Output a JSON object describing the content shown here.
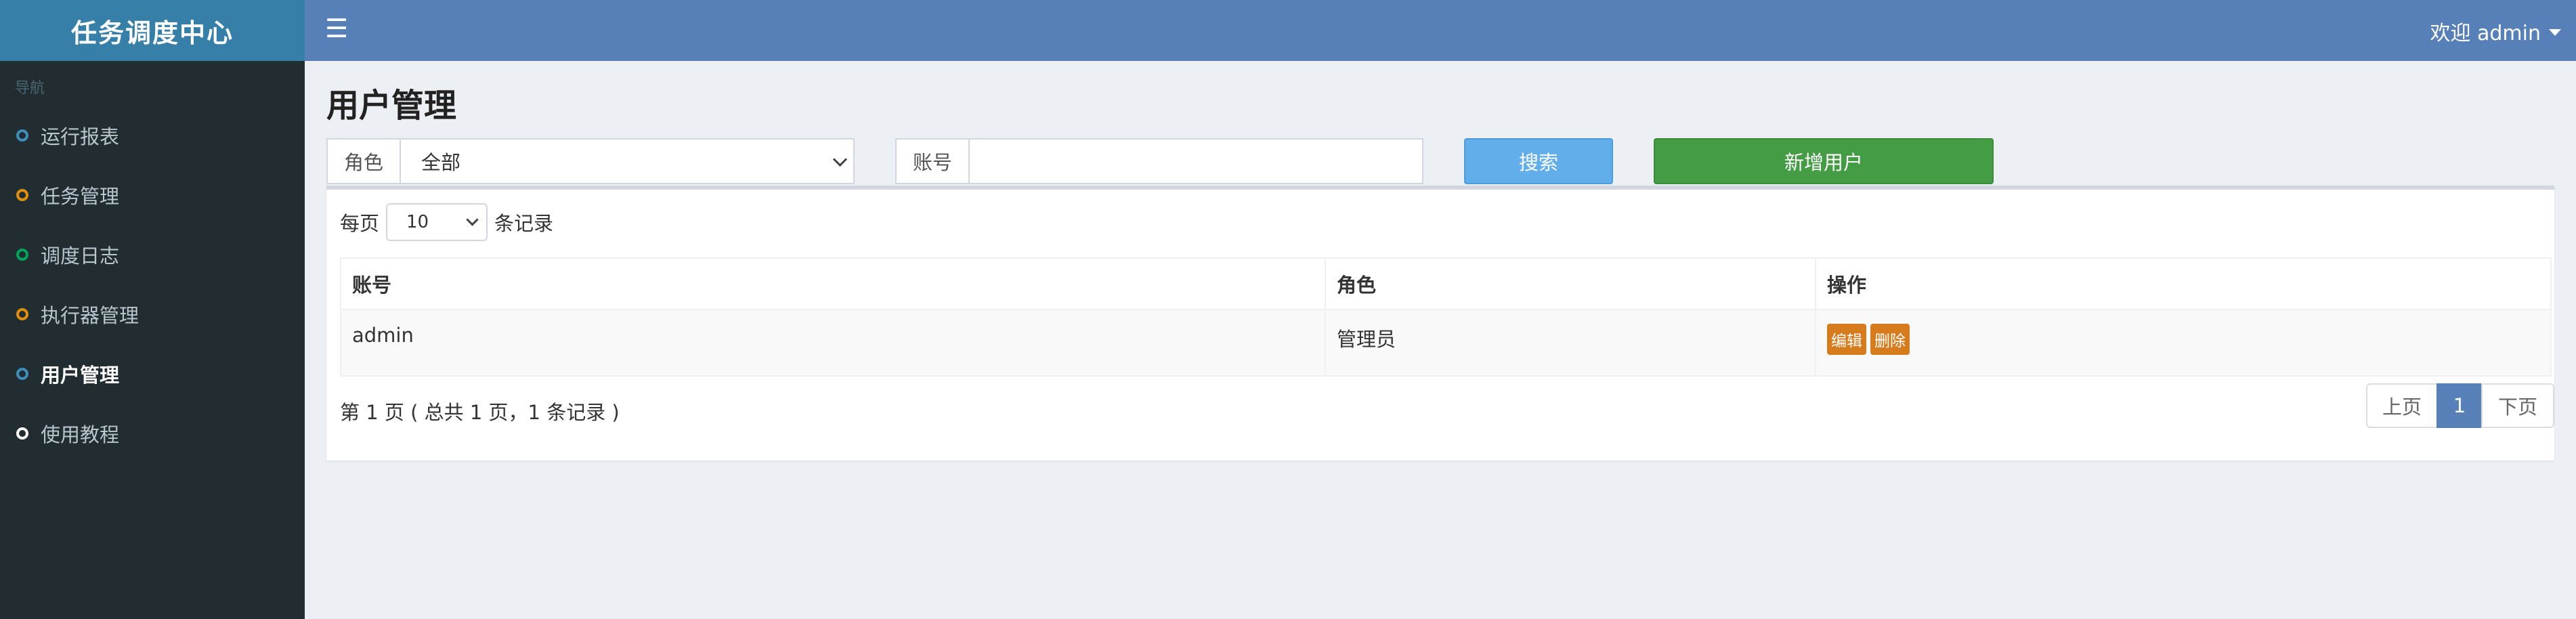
{
  "brand": "任务调度中心",
  "header": {
    "welcome": "欢迎 admin"
  },
  "sidebar": {
    "section": "导航",
    "items": [
      {
        "label": "运行报表",
        "color": "#3c8dbc"
      },
      {
        "label": "任务管理",
        "color": "#e08e0b"
      },
      {
        "label": "调度日志",
        "color": "#00a65a"
      },
      {
        "label": "执行器管理",
        "color": "#e08e0b"
      },
      {
        "label": "用户管理",
        "color": "#3c8dbc",
        "active": true
      },
      {
        "label": "使用教程",
        "color": "#ffffff"
      }
    ]
  },
  "main": {
    "title": "用户管理",
    "filters": {
      "role_label": "角色",
      "role_value": "全部",
      "account_label": "账号",
      "account_value": ""
    },
    "buttons": {
      "search": "搜索",
      "add": "新增用户"
    },
    "per_page": {
      "prefix": "每页",
      "value": "10",
      "suffix": "条记录"
    },
    "table": {
      "columns": [
        "账号",
        "角色",
        "操作"
      ],
      "rows": [
        {
          "account": "admin",
          "role": "管理员",
          "actions": [
            "编辑",
            "删除"
          ]
        }
      ]
    },
    "summary": "第 1 页 ( 总共 1 页，1 条记录 )",
    "pagination": {
      "prev": "上页",
      "current": "1",
      "next": "下页"
    }
  }
}
